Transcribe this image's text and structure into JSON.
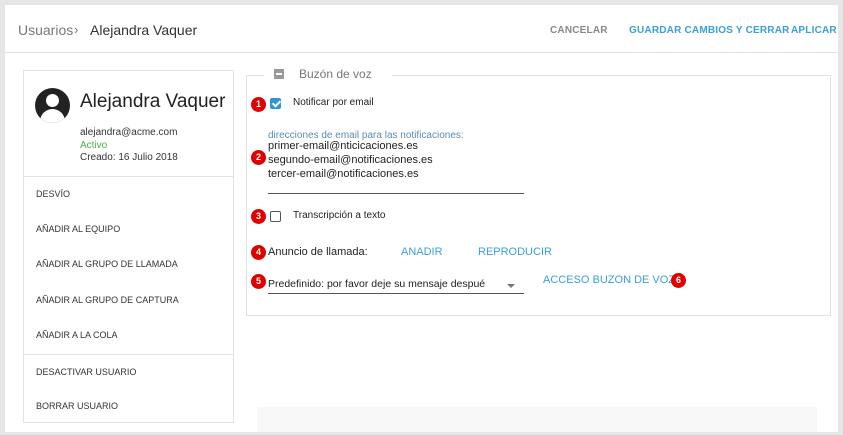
{
  "breadcrumb": {
    "root": "Usuarios",
    "separator": "›",
    "current": "Alejandra Vaquer"
  },
  "header": {
    "cancel_label": "CANCELAR",
    "save_close_label": "GUARDAR CAMBIOS Y CERRAR",
    "apply_label": "APLICAR"
  },
  "profile": {
    "name": "Alejandra Vaquer",
    "email": "alejandra@acme.com",
    "status": "Activo",
    "created": "Creado: 16 Julio 2018",
    "status_color": "#4caf50"
  },
  "menu": {
    "items": [
      {
        "label": "DESVÍO"
      },
      {
        "label": "AÑADIR AL EQUIPO"
      },
      {
        "label": "AÑADIR AL GRUPO DE LLAMADA"
      },
      {
        "label": "AÑADIR AL GRUPO DE CAPTURA"
      },
      {
        "label": "AÑADIR A LA COLA"
      },
      {
        "label": "DESACTIVAR USUARIO"
      },
      {
        "label": "BORRAR USUARIO"
      }
    ]
  },
  "voicemail": {
    "title": "Buzón de voz",
    "notify_email": {
      "label": "Notificar por email",
      "checked": true
    },
    "emails_label": "direcciones de email para las notificaciones:",
    "emails": [
      "primer-email@nticicaciones.es",
      "segundo-email@notificaciones.es",
      "tercer-email@notificaciones.es"
    ],
    "transcription": {
      "label": "Transcripción a texto",
      "checked": false
    },
    "announcement": {
      "label": "Anuncio de llamada:",
      "add_label": "ANADIR",
      "play_label": "REPRODUCIR"
    },
    "greeting": {
      "selected": "Predefinido: por favor deje su mensaje despué"
    },
    "access_label": "ACCESO BUZON DE VOZ"
  },
  "badges": [
    "1",
    "2",
    "3",
    "4",
    "5",
    "6"
  ],
  "colors": {
    "accent": "#3aa0d8",
    "badge": "#e10000",
    "checkbox": "#2f96d4"
  }
}
